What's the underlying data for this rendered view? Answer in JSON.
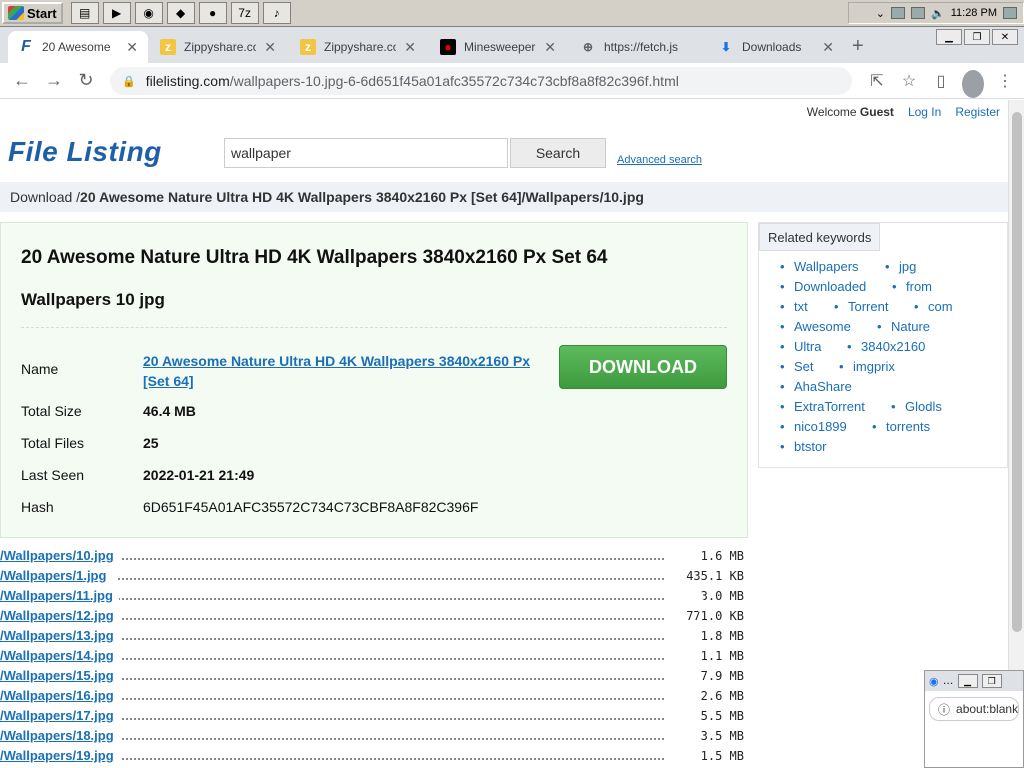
{
  "taskbar": {
    "start_label": "Start",
    "clock": "11:28 PM"
  },
  "browser": {
    "tabs": [
      {
        "title": "20 Awesome",
        "icon": "file-listing-icon"
      },
      {
        "title": "Zippyshare.co",
        "icon": "zippyshare-icon"
      },
      {
        "title": "Zippyshare.co",
        "icon": "zippyshare-icon"
      },
      {
        "title": "Minesweeper",
        "icon": "minesweeper-icon"
      },
      {
        "title": "https://fetch.js",
        "icon": "globe-icon"
      },
      {
        "title": "Downloads",
        "icon": "download-icon"
      }
    ],
    "url_domain": "filelisting.com",
    "url_path": "/wallpapers-10.jpg-6-6d651f45a01afc35572c734c73cbf8a8f82c396f.html"
  },
  "site": {
    "welcome_prefix": "Welcome",
    "welcome_user": "Guest",
    "login": "Log In",
    "register": "Register",
    "logo": "File Listing",
    "search_value": "wallpaper",
    "search_button": "Search",
    "advanced_search": "Advanced search",
    "breadcrumb_prefix": "Download /",
    "breadcrumb_path": "20 Awesome Nature Ultra HD 4K Wallpapers 3840x2160 Px [Set 64]/Wallpapers/10.jpg"
  },
  "detail": {
    "title_line1": "20 Awesome Nature Ultra HD 4K Wallpapers 3840x2160 Px Set 64",
    "title_line2": "Wallpapers 10 jpg",
    "name_label": "Name",
    "name_value": "20 Awesome Nature Ultra HD 4K Wallpapers 3840x2160 Px [Set 64]",
    "size_label": "Total Size",
    "size_value": "46.4 MB",
    "files_label": "Total Files",
    "files_value": "25",
    "seen_label": "Last Seen",
    "seen_value": "2022-01-21 21:49",
    "hash_label": "Hash",
    "hash_value": "6D651F45A01AFC35572C734C73CBF8A8F82C396F",
    "download_button": "DOWNLOAD"
  },
  "related": {
    "header": "Related keywords",
    "keywords": [
      "Wallpapers",
      "jpg",
      "Downloaded",
      "from",
      "txt",
      "Torrent",
      "com",
      "Awesome",
      "Nature",
      "Ultra",
      "3840x2160",
      "Set",
      "imgprix",
      "AhaShare",
      "ExtraTorrent",
      "Glodls",
      "nico1899",
      "torrents",
      "btstor"
    ]
  },
  "files": [
    {
      "name": "/Wallpapers/10.jpg",
      "size": "1.6 MB"
    },
    {
      "name": "/Wallpapers/1.jpg",
      "size": "435.1 KB"
    },
    {
      "name": "/Wallpapers/11.jpg",
      "size": "3.0 MB"
    },
    {
      "name": "/Wallpapers/12.jpg",
      "size": "771.0 KB"
    },
    {
      "name": "/Wallpapers/13.jpg",
      "size": "1.8 MB"
    },
    {
      "name": "/Wallpapers/14.jpg",
      "size": "1.1 MB"
    },
    {
      "name": "/Wallpapers/15.jpg",
      "size": "7.9 MB"
    },
    {
      "name": "/Wallpapers/16.jpg",
      "size": "2.6 MB"
    },
    {
      "name": "/Wallpapers/17.jpg",
      "size": "5.5 MB"
    },
    {
      "name": "/Wallpapers/18.jpg",
      "size": "3.5 MB"
    },
    {
      "name": "/Wallpapers/19.jpg",
      "size": "1.5 MB"
    }
  ],
  "mini_window": {
    "address": "about:blank"
  }
}
